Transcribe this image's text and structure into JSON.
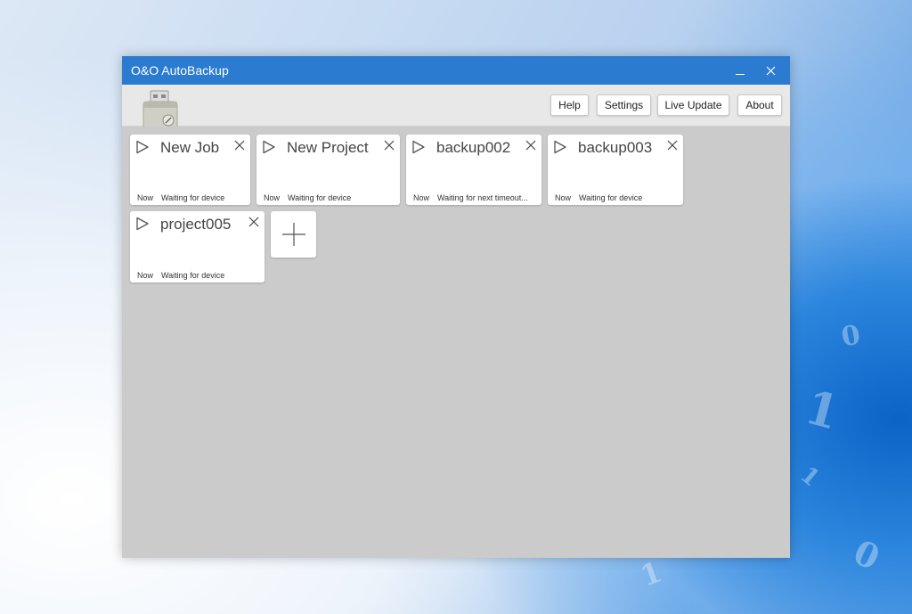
{
  "window": {
    "title": "O&O AutoBackup"
  },
  "toolbar": {
    "buttons": [
      {
        "label": "Help"
      },
      {
        "label": "Settings"
      },
      {
        "label": "Live Update"
      },
      {
        "label": "About"
      }
    ]
  },
  "jobs": [
    {
      "name": "New Job",
      "when": "Now",
      "status": "Waiting for device"
    },
    {
      "name": "New Project",
      "when": "Now",
      "status": "Waiting for device"
    },
    {
      "name": "backup002",
      "when": "Now",
      "status": "Waiting for next timeout..."
    },
    {
      "name": "backup003",
      "when": "Now",
      "status": "Waiting for device"
    },
    {
      "name": "project005",
      "when": "Now",
      "status": "Waiting for device"
    }
  ],
  "icons": {
    "play": "play-icon",
    "close": "close-icon",
    "add": "plus-icon",
    "logo": "usb-drive-icon"
  },
  "colors": {
    "titlebar": "#2b7bd0",
    "content_bg": "#cbcbcb",
    "toolbar_bg": "#e8e8e8"
  }
}
